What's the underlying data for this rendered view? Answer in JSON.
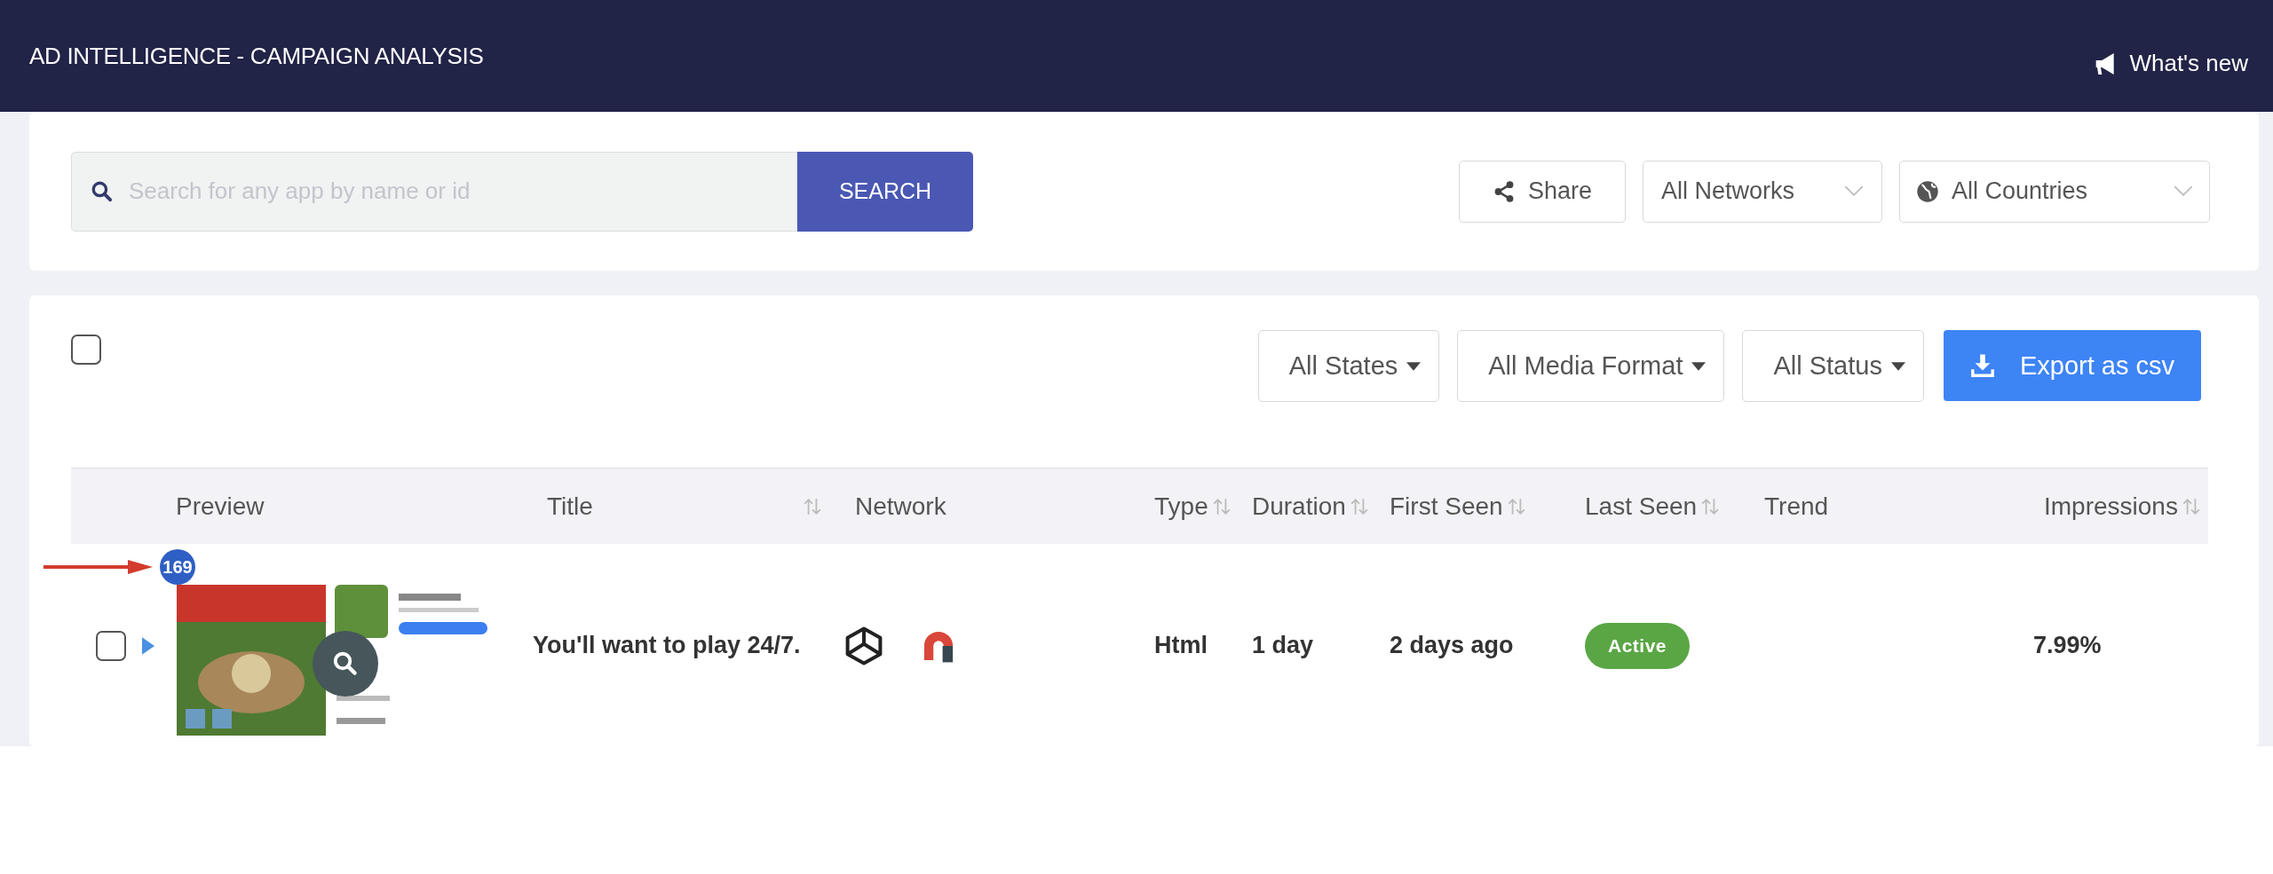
{
  "header": {
    "title": "AD INTELLIGENCE - CAMPAIGN ANALYSIS",
    "whats_new": "What's new"
  },
  "search": {
    "placeholder": "Search for any app by name or id",
    "button": "SEARCH"
  },
  "toolbar": {
    "share": "Share",
    "networks": "All Networks",
    "countries": "All Countries"
  },
  "select_all": {
    "checked": false
  },
  "filters": [
    "All States",
    "All Media Format",
    "All Status"
  ],
  "export": "Export as csv",
  "table": {
    "columns": [
      {
        "label": "Preview",
        "sortable": false
      },
      {
        "label": "Title",
        "sortable": true
      },
      {
        "label": "Network",
        "sortable": false
      },
      {
        "label": "Type",
        "sortable": true
      },
      {
        "label": "Duration",
        "sortable": true
      },
      {
        "label": "First Seen",
        "sortable": true
      },
      {
        "label": "Last Seen",
        "sortable": true
      },
      {
        "label": "Trend",
        "sortable": false
      },
      {
        "label": "Impressions",
        "sortable": true
      }
    ],
    "rows": [
      {
        "checked": false,
        "expanded": false,
        "preview": {
          "kind": "picture",
          "count": "169"
        },
        "title": "You'll want to play 24/7.",
        "type": "Html",
        "duration": "1 day",
        "first_seen": "2 days ago",
        "last_seen": "Active",
        "impressions": "7.99%"
      }
    ]
  }
}
